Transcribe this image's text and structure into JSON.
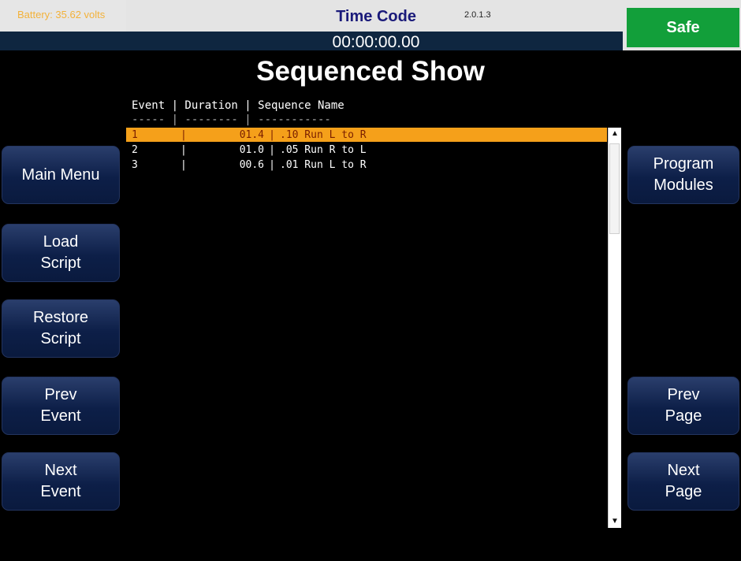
{
  "status": {
    "battery_text": "Battery: 35.62 volts",
    "battery_level": 0.3,
    "version": "2.0.1.3",
    "timecode_label": "Time Code",
    "timecode_value": "00:00:00.00",
    "state": "Safe"
  },
  "title": "Sequenced Show",
  "table": {
    "headers": [
      "Event",
      "Duration",
      "Sequence Name"
    ],
    "header_line": "Event | Duration | Sequence Name",
    "separator_line": "----- | -------- | -----------",
    "rows": [
      {
        "event": "1",
        "duration": "01.4",
        "name": ".10 Run L to R",
        "selected": true
      },
      {
        "event": "2",
        "duration": "01.0",
        "name": ".05 Run R to L",
        "selected": false
      },
      {
        "event": "3",
        "duration": "00.6",
        "name": ".01 Run L to R",
        "selected": false
      }
    ]
  },
  "left_buttons": [
    "Main Menu",
    "Load\nScript",
    "Restore\nScript",
    "Prev\nEvent",
    "Next\nEvent"
  ],
  "right_buttons": [
    "Program\nModules",
    "Prev\nPage",
    "Next\nPage"
  ],
  "colors": {
    "safe": "#129f3a",
    "selection": "#f5a01a",
    "battery_text": "#f3b23a",
    "button": "#0d1f48"
  },
  "icons": [
    "scroll-up-arrow-icon",
    "scroll-down-arrow-icon"
  ]
}
